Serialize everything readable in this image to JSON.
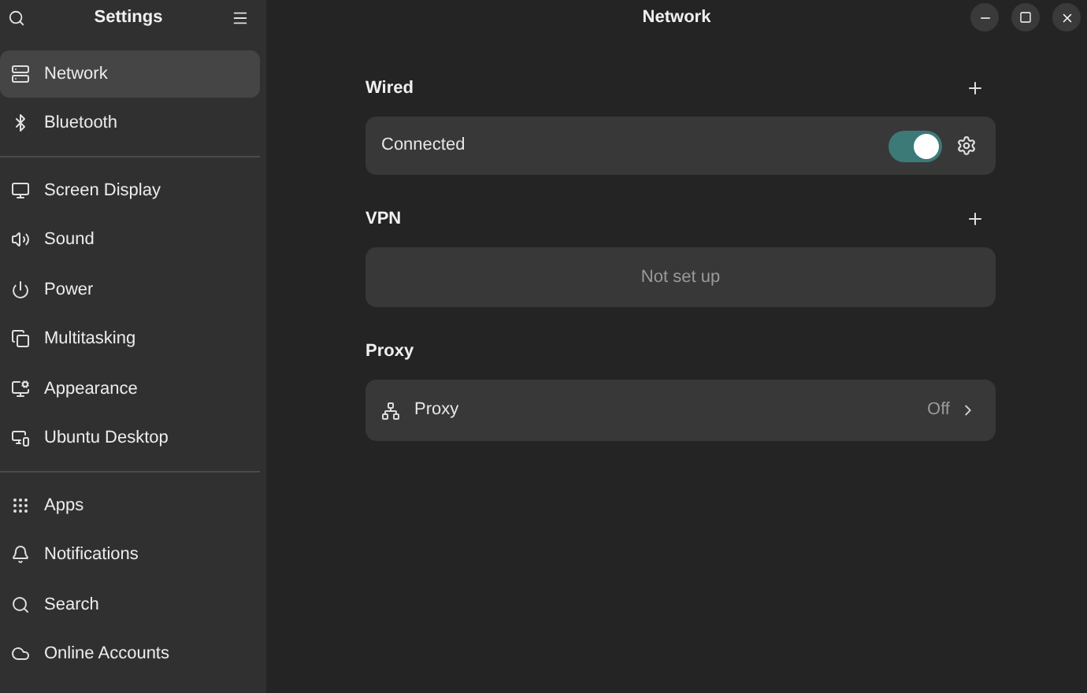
{
  "sidebar": {
    "title": "Settings",
    "groups": [
      {
        "items": [
          {
            "label": "Network",
            "selected": true
          },
          {
            "label": "Bluetooth",
            "selected": false
          }
        ]
      },
      {
        "items": [
          {
            "label": "Screen Display",
            "selected": false
          },
          {
            "label": "Sound",
            "selected": false
          },
          {
            "label": "Power",
            "selected": false
          },
          {
            "label": "Multitasking",
            "selected": false
          },
          {
            "label": "Appearance",
            "selected": false
          },
          {
            "label": "Ubuntu Desktop",
            "selected": false
          }
        ]
      },
      {
        "items": [
          {
            "label": "Apps",
            "selected": false
          },
          {
            "label": "Notifications",
            "selected": false
          },
          {
            "label": "Search",
            "selected": false
          },
          {
            "label": "Online Accounts",
            "selected": false
          }
        ]
      }
    ]
  },
  "window": {
    "title": "Network"
  },
  "sections": [
    {
      "kind": "switch",
      "heading": "Wired",
      "label": "Connected",
      "on": true
    },
    {
      "kind": "empty",
      "heading": "VPN",
      "label": "Not set up"
    },
    {
      "kind": "link",
      "heading": "Proxy",
      "label": "Proxy",
      "value": "Off"
    }
  ]
}
